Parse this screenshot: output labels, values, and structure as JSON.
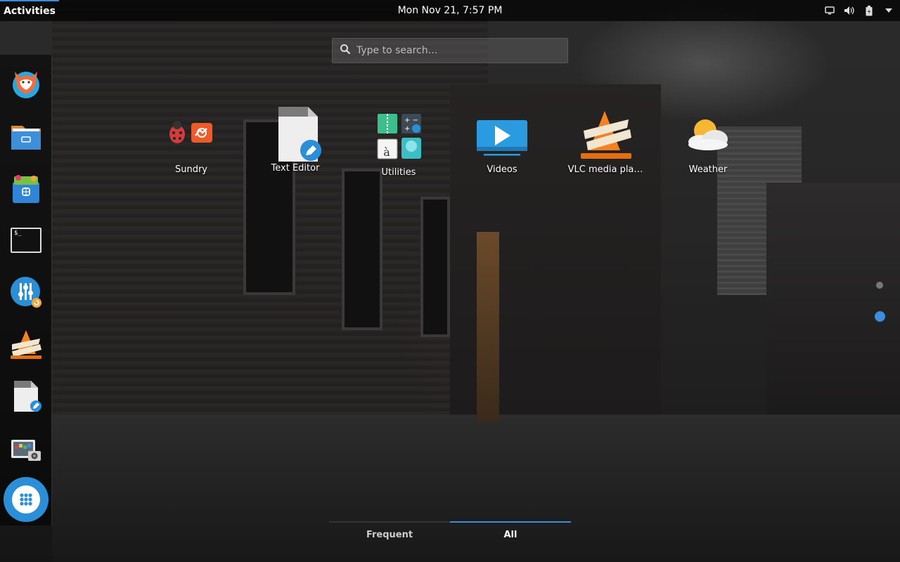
{
  "topbar": {
    "activities_label": "Activities",
    "clock": "Mon Nov 21,  7:57 PM",
    "tray": [
      "screen-icon",
      "volume-icon",
      "battery-icon",
      "power-menu-icon"
    ]
  },
  "search": {
    "placeholder": "Type to search…",
    "value": ""
  },
  "dash": {
    "items": [
      {
        "name": "firefox",
        "icon": "firefox-icon"
      },
      {
        "name": "files",
        "icon": "files-icon"
      },
      {
        "name": "software",
        "icon": "software-store-icon"
      },
      {
        "name": "terminal",
        "icon": "terminal-icon",
        "text": "$_"
      },
      {
        "name": "settings",
        "icon": "settings-icon"
      },
      {
        "name": "vlc",
        "icon": "vlc-icon"
      },
      {
        "name": "text-editor",
        "icon": "text-editor-icon"
      },
      {
        "name": "image-viewer",
        "icon": "image-viewer-icon"
      },
      {
        "name": "show-applications",
        "icon": "app-grid-icon"
      }
    ]
  },
  "apps": [
    {
      "label": "Sundry",
      "icon": "sundry-folder-icon"
    },
    {
      "label": "Text Editor",
      "icon": "text-editor-icon"
    },
    {
      "label": "Utilities",
      "icon": "utilities-folder-icon",
      "text": "à"
    },
    {
      "label": "Videos",
      "icon": "videos-icon"
    },
    {
      "label": "VLC media pla…",
      "icon": "vlc-icon"
    },
    {
      "label": "Weather",
      "icon": "weather-icon"
    }
  ],
  "switcher": {
    "frequent_label": "Frequent",
    "all_label": "All",
    "active": "All"
  },
  "pages": {
    "count": 2,
    "current": 2
  },
  "colors": {
    "accent": "#3b8ede",
    "page_dot_active": "#3b8ede",
    "page_dot_inactive": "#777777"
  }
}
